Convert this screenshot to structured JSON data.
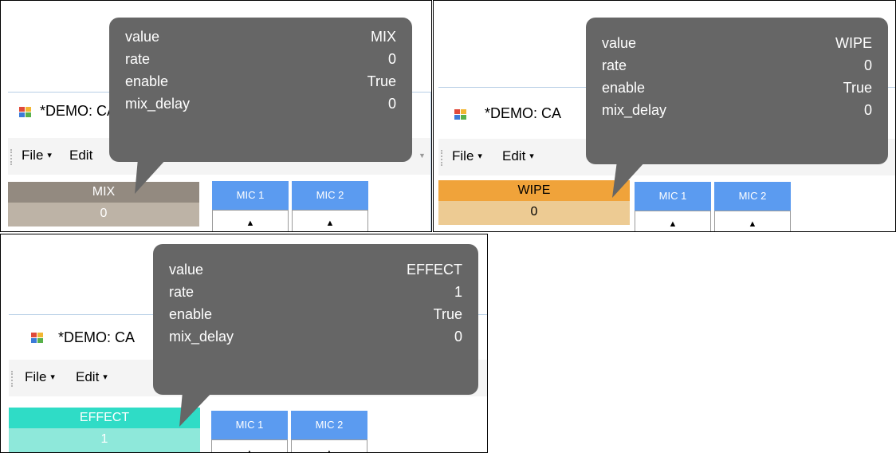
{
  "window_title": "*DEMO: CA",
  "menu": {
    "file": "File",
    "edit": "Edit",
    "caret": "▾"
  },
  "mics": {
    "mic1": "MIC 1",
    "mic2": "MIC 2",
    "arrow": "▲"
  },
  "tooltip_keys": {
    "value": "value",
    "rate": "rate",
    "enable": "enable",
    "mix_delay": "mix_delay"
  },
  "panels": [
    {
      "mode_label": "MIX",
      "mode_value": "0",
      "colors": {
        "label_bg": "#938a80",
        "value_bg": "#bdb3a6"
      },
      "tooltip": {
        "value": "MIX",
        "rate": "0",
        "enable": "True",
        "mix_delay": "0"
      }
    },
    {
      "mode_label": "WIPE",
      "mode_value": "0",
      "colors": {
        "label_bg": "#f0a33a",
        "value_bg": "#edcb93"
      },
      "tooltip": {
        "value": "WIPE",
        "rate": "0",
        "enable": "True",
        "mix_delay": "0"
      }
    },
    {
      "mode_label": "EFFECT",
      "mode_value": "1",
      "colors": {
        "label_bg": "#2fdcc6",
        "value_bg": "#8ee8da"
      },
      "tooltip": {
        "value": "EFFECT",
        "rate": "1",
        "enable": "True",
        "mix_delay": "0"
      }
    }
  ]
}
